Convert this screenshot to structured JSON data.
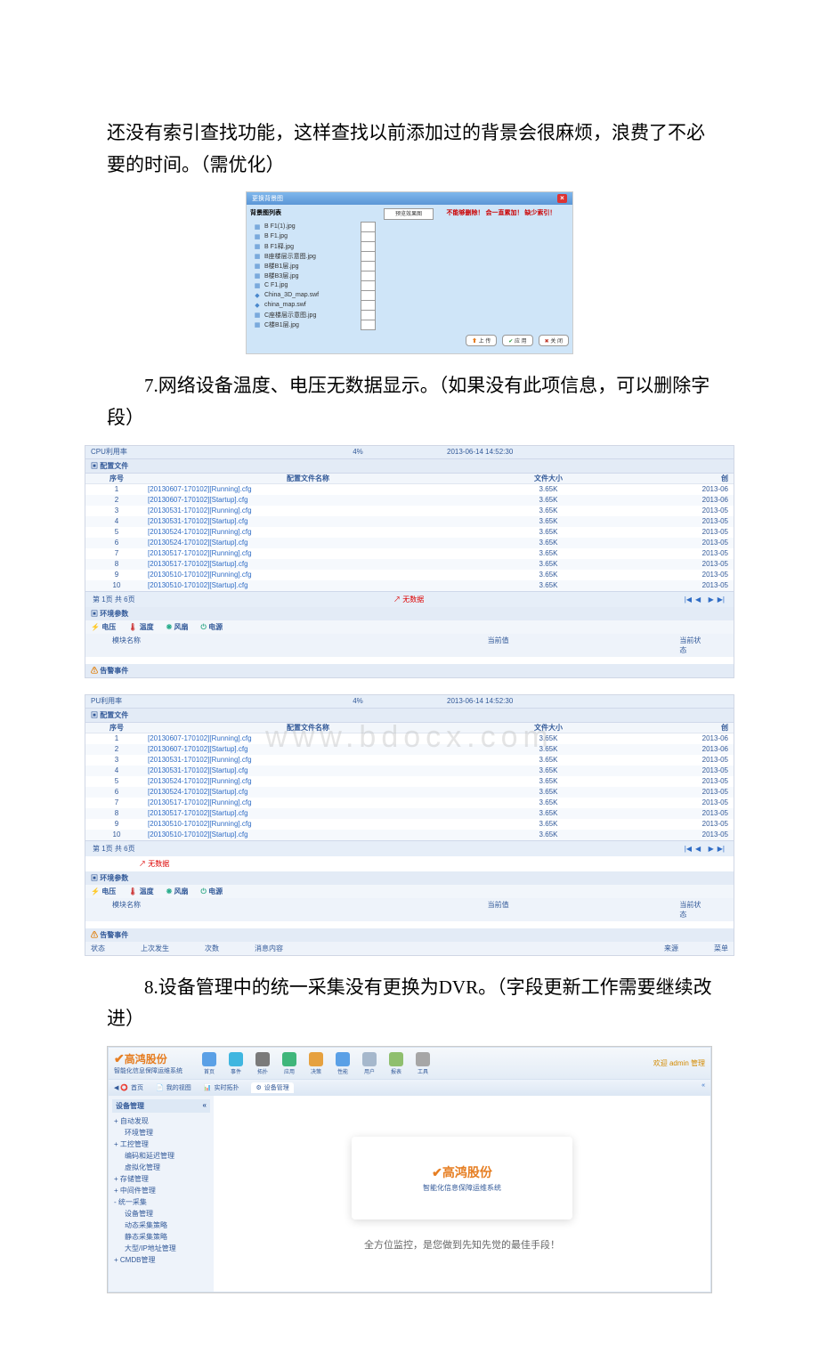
{
  "paragraphs": {
    "p1": "还没有索引查找功能，这样查找以前添加过的背景会很麻烦，浪费了不必要的时间。（需优化）",
    "p7": "7.网络设备温度、电压无数据显示。（如果没有此项信息，可以删除字段）",
    "p8": "8.设备管理中的统一采集没有更换为DVR。（字段更新工作需要继续改进）"
  },
  "dlg": {
    "title": "更换背景图",
    "col_list": "背景图列表",
    "col_preview": "预览效果图",
    "warn": "不能够删除！  会一直累加！  缺少索引！",
    "items": [
      "B F1(1).jpg",
      "B F1.jpg",
      "B F1释.jpg",
      "B座楼层示意图.jpg",
      "B楼B1层.jpg",
      "B楼B3层.jpg",
      "C F1.jpg",
      "China_3D_map.swf",
      "china_map.swf",
      "C座楼层示意图.jpg",
      "C楼B1层.jpg"
    ],
    "btn_upload": "上 传",
    "btn_apply": "应 用",
    "btn_close": "关 闭"
  },
  "cfg": {
    "cpu_label": "CPU利用率",
    "cpu_value": "4%",
    "cpu_time": "2013-06-14 14:52:30",
    "section": "配置文件",
    "col_idx": "序号",
    "col_name": "配置文件名称",
    "col_size": "文件大小",
    "col_other": "创",
    "pager": "第 1页 共 6页",
    "nodata": "无数据",
    "env_title": "环境参数",
    "tab_volt": "电压",
    "tab_temp": "温度",
    "tab_fan": "风扇",
    "tab_power": "电源",
    "stat_mod": "模块名称",
    "stat_val": "当前值",
    "stat_state": "当前状态",
    "alarm_title": "告警事件",
    "alarm_state": "状态",
    "alarm_last": "上次发生",
    "alarm_count": "次数",
    "alarm_msg": "消息内容",
    "alarm_src": "来源",
    "alarm_menu": "菜单",
    "rows": [
      {
        "i": "1",
        "n": "[20130607-170102][Running].cfg",
        "s": "3.65K",
        "d": "2013-06"
      },
      {
        "i": "2",
        "n": "[20130607-170102][Startup].cfg",
        "s": "3.65K",
        "d": "2013-06"
      },
      {
        "i": "3",
        "n": "[20130531-170102][Running].cfg",
        "s": "3.65K",
        "d": "2013-05"
      },
      {
        "i": "4",
        "n": "[20130531-170102][Startup].cfg",
        "s": "3.65K",
        "d": "2013-05"
      },
      {
        "i": "5",
        "n": "[20130524-170102][Running].cfg",
        "s": "3.65K",
        "d": "2013-05"
      },
      {
        "i": "6",
        "n": "[20130524-170102][Startup].cfg",
        "s": "3.65K",
        "d": "2013-05"
      },
      {
        "i": "7",
        "n": "[20130517-170102][Running].cfg",
        "s": "3.65K",
        "d": "2013-05"
      },
      {
        "i": "8",
        "n": "[20130517-170102][Startup].cfg",
        "s": "3.65K",
        "d": "2013-05"
      },
      {
        "i": "9",
        "n": "[20130510-170102][Running].cfg",
        "s": "3.65K",
        "d": "2013-05"
      },
      {
        "i": "10",
        "n": "[20130510-170102][Startup].cfg",
        "s": "3.65K",
        "d": "2013-05"
      }
    ]
  },
  "watermark": "www.bdocx.com",
  "dash": {
    "brand": "高鸿股份",
    "subtitle": "智能化信息保障运维系统",
    "login": "欢迎  admin  管理",
    "menu": [
      {
        "label": "首页",
        "color": "#5aa0e6"
      },
      {
        "label": "事件",
        "color": "#3fb6e0"
      },
      {
        "label": "拓扑",
        "color": "#7a7a7a"
      },
      {
        "label": "应用",
        "color": "#3fb67b"
      },
      {
        "label": "决策",
        "color": "#e6a13f"
      },
      {
        "label": "性能",
        "color": "#5aa0e6"
      },
      {
        "label": "用户",
        "color": "#a6b8cc"
      },
      {
        "label": "报表",
        "color": "#8fbf6e"
      },
      {
        "label": "工具",
        "color": "#a6a6a6"
      }
    ],
    "tabs": [
      "首页",
      "我的视图",
      "实时拓扑",
      "设备管理"
    ],
    "side_title": "设备管理",
    "tree": [
      "+ 自动发现",
      "  环境管理",
      "+ 工控管理",
      "  编码和延迟管理",
      "  虚拟化管理",
      "+ 存储管理",
      "+ 中间件管理",
      "- 统一采集",
      "  设备管理",
      "  动态采集策略",
      "  静态采集策略",
      "  大型/IP地址管理",
      "+ CMDB管理"
    ],
    "slogan": "全方位监控，是您做到先知先觉的最佳手段！"
  }
}
